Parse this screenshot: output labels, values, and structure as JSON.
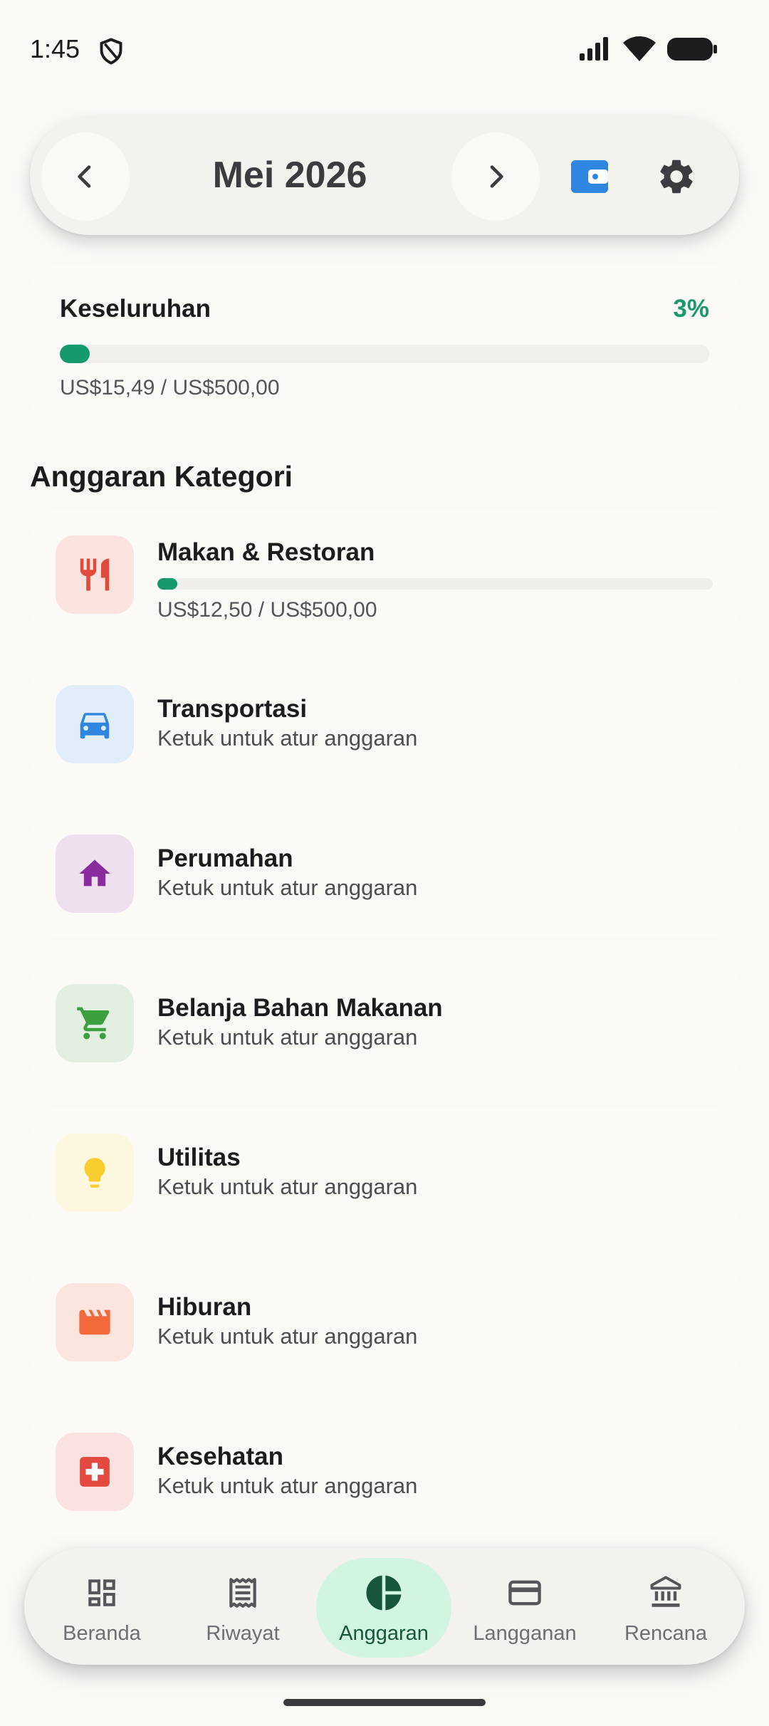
{
  "status_bar": {
    "time": "1:45"
  },
  "header": {
    "month_title": "Mei 2026"
  },
  "overall": {
    "label": "Keseluruhan",
    "percent": "3%",
    "progress_fraction": 0.03,
    "amount": "US$15,49 / US$500,00",
    "color": "#159a6b"
  },
  "section_title": "Anggaran Kategori",
  "categories": [
    {
      "name": "Makan & Restoran",
      "amount": "US$12,50 / US$500,00",
      "progress_fraction": 0.025,
      "icon": "restaurant-icon",
      "icon_color": "#e24b3b",
      "bg": "#fbe4e0"
    },
    {
      "name": "Transportasi",
      "subtitle": "Ketuk untuk atur anggaran",
      "icon": "car-icon",
      "icon_color": "#2f86e0",
      "bg": "#e1edf8"
    },
    {
      "name": "Perumahan",
      "subtitle": "Ketuk untuk atur anggaran",
      "icon": "home-icon",
      "icon_color": "#8a2ba0",
      "bg": "#efe0f0"
    },
    {
      "name": "Belanja Bahan Makanan",
      "subtitle": "Ketuk untuk atur anggaran",
      "icon": "cart-icon",
      "icon_color": "#3da03f",
      "bg": "#e3f0e1"
    },
    {
      "name": "Utilitas",
      "subtitle": "Ketuk untuk atur anggaran",
      "icon": "lightbulb-icon",
      "icon_color": "#f8cd2d",
      "bg": "#fcf7de"
    },
    {
      "name": "Hiburan",
      "subtitle": "Ketuk untuk atur anggaran",
      "icon": "movie-icon",
      "icon_color": "#f26a3c",
      "bg": "#fbe6df"
    },
    {
      "name": "Kesehatan",
      "subtitle": "Ketuk untuk atur anggaran",
      "icon": "medical-icon",
      "icon_color": "#e5483f",
      "bg": "#fae2e0"
    }
  ],
  "bottom_nav": [
    {
      "label": "Beranda",
      "icon": "dashboard-icon"
    },
    {
      "label": "Riwayat",
      "icon": "receipt-icon"
    },
    {
      "label": "Anggaran",
      "icon": "budget-pie-icon",
      "active": true
    },
    {
      "label": "Langganan",
      "icon": "card-icon"
    },
    {
      "label": "Rencana",
      "icon": "bank-icon"
    }
  ],
  "colors": {
    "accent": "#159a6b",
    "active_nav_bg": "#d2f5e2",
    "wallet": "#2f86e0"
  }
}
